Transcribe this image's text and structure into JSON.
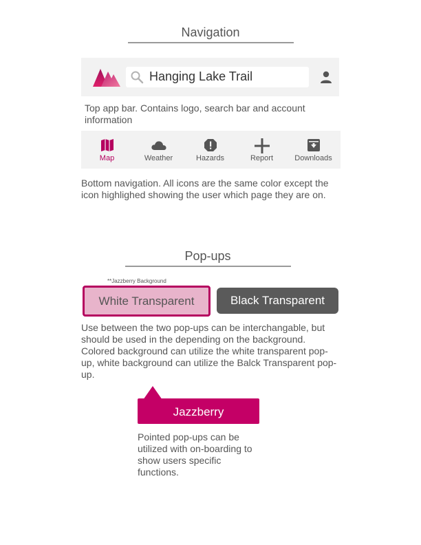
{
  "navigation_section": {
    "title": "Navigation",
    "app_bar": {
      "search_text": "Hanging Lake Trail",
      "logo_icon": "mountain-logo-icon",
      "search_icon": "search-icon",
      "account_icon": "account-icon"
    },
    "app_bar_caption": "Top app bar. Contains logo, search bar and account information",
    "bottom_nav": {
      "items": [
        {
          "label": "Map",
          "icon": "map-icon",
          "active": true
        },
        {
          "label": "Weather",
          "icon": "cloud-icon",
          "active": false
        },
        {
          "label": "Hazards",
          "icon": "alert-icon",
          "active": false
        },
        {
          "label": "Report",
          "icon": "plus-icon",
          "active": false
        },
        {
          "label": "Downloads",
          "icon": "download-box-icon",
          "active": false
        }
      ]
    },
    "bottom_nav_caption": "Bottom navigation. All icons are the same color except the icon highlighed showing the user which page they are on."
  },
  "popups_section": {
    "title": "Pop-ups",
    "background_note": "**Jazzberry Background",
    "white_transparent_label": "White Transparent",
    "black_transparent_label": "Black Transparent",
    "popups_caption": "Use between the two pop-ups can be interchangable, but should be used in the depending on the background. Colored background can utilize the white transparent pop-up, white background can utilize the Balck Transparent pop-up.",
    "pointed_popup_label": "Jazzberry",
    "pointed_popup_caption": "Pointed pop-ups can be utilized with on-boarding to show users specific functions."
  },
  "colors": {
    "jazzberry": "#c40066",
    "active_nav": "#b5005f",
    "icon_gray": "#555555",
    "bar_background": "#f2f2f2",
    "white_transparent_fill": "#e8b4cb",
    "black_transparent_fill": "#5a5a5a"
  }
}
